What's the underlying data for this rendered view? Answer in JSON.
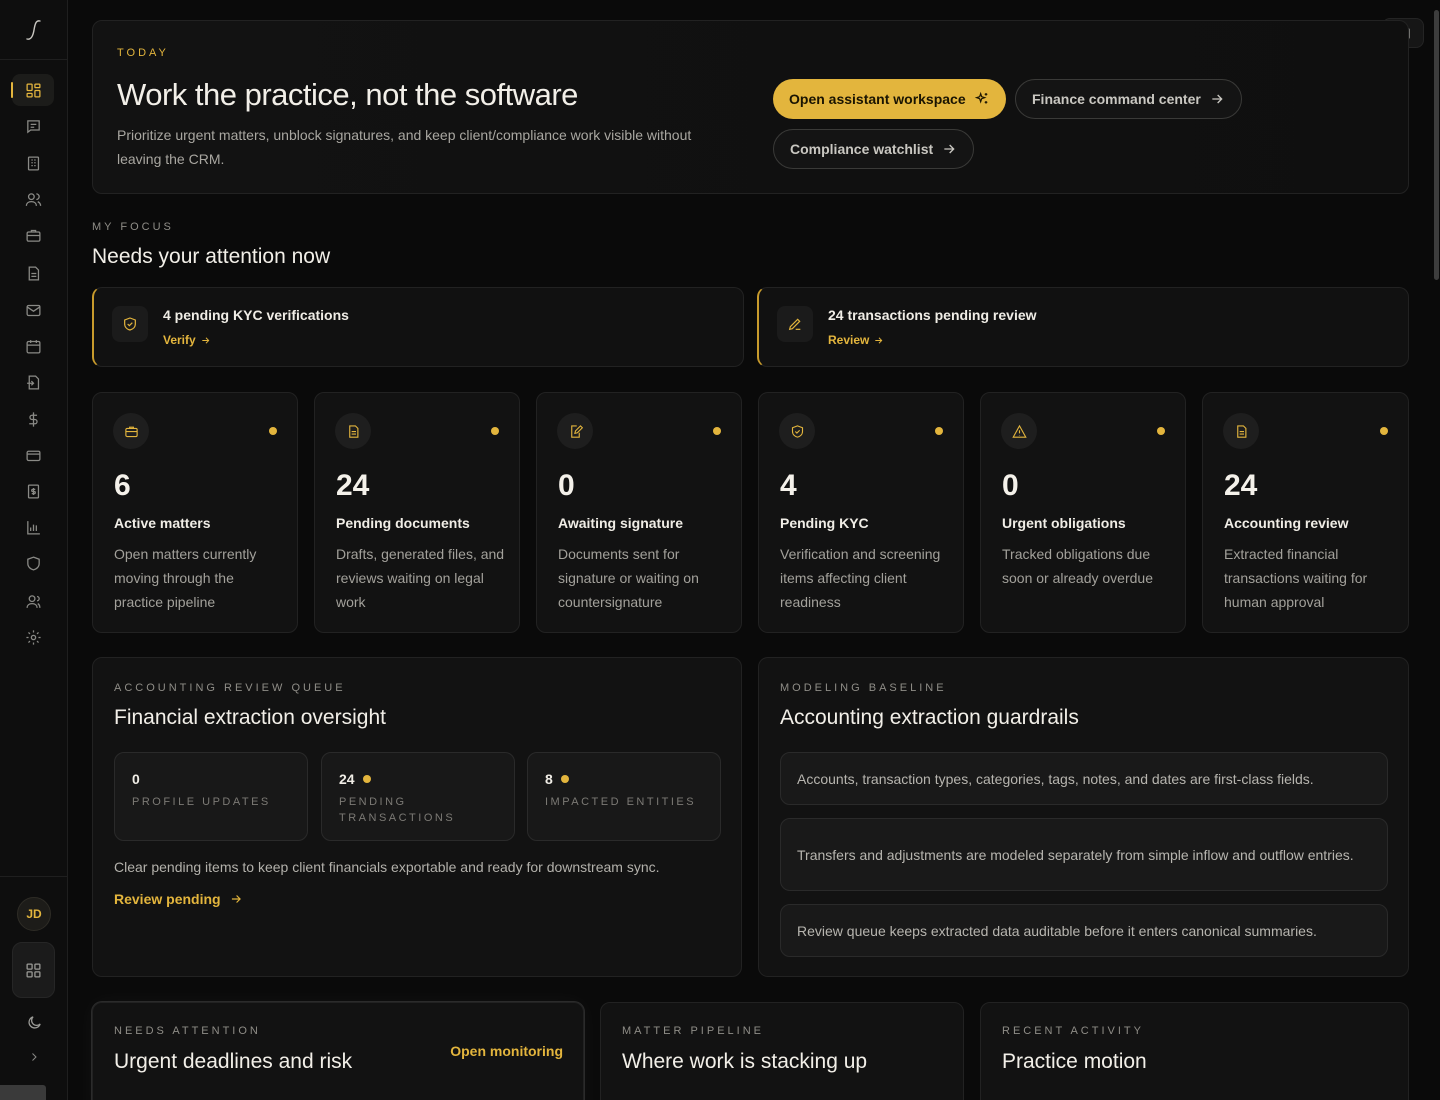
{
  "hero": {
    "eyebrow": "TODAY",
    "title": "Work the practice, not the software",
    "description": "Prioritize urgent matters, unblock signatures, and keep client/compliance work visible without leaving the CRM.",
    "primary_button": "Open assistant workspace",
    "finance_button": "Finance command center",
    "compliance_button": "Compliance watchlist"
  },
  "sidebar": {
    "avatar_initials": "JD",
    "items": [
      "dashboard-icon",
      "messages-icon",
      "building-icon",
      "users-icon",
      "briefcase-icon",
      "document-icon",
      "mail-icon",
      "calendar-icon",
      "file-import-icon",
      "dollar-icon",
      "card-icon",
      "invoice-icon",
      "chart-icon",
      "shield-icon",
      "team-icon",
      "settings-icon"
    ]
  },
  "focus": {
    "eyebrow": "MY FOCUS",
    "title": "Needs your attention now",
    "items": [
      {
        "title": "4 pending KYC verifications",
        "link": "Verify",
        "icon": "shield-check-icon"
      },
      {
        "title": "24 transactions pending review",
        "link": "Review",
        "icon": "pencil-icon"
      }
    ]
  },
  "stats": [
    {
      "value": "6",
      "label": "Active matters",
      "desc": "Open matters currently moving through the practice pipeline",
      "icon": "briefcase-icon"
    },
    {
      "value": "24",
      "label": "Pending documents",
      "desc": "Drafts, generated files, and reviews waiting on legal work",
      "icon": "document-icon"
    },
    {
      "value": "0",
      "label": "Awaiting signature",
      "desc": "Documents sent for signature or waiting on countersignature",
      "icon": "signature-icon"
    },
    {
      "value": "4",
      "label": "Pending KYC",
      "desc": "Verification and screening items affecting client readiness",
      "icon": "shield-check-icon"
    },
    {
      "value": "0",
      "label": "Urgent obligations",
      "desc": "Tracked obligations due soon or already overdue",
      "icon": "warning-icon"
    },
    {
      "value": "24",
      "label": "Accounting review",
      "desc": "Extracted financial transactions waiting for human approval",
      "icon": "document-icon"
    }
  ],
  "queue": {
    "eyebrow": "ACCOUNTING REVIEW QUEUE",
    "title": "Financial extraction oversight",
    "metrics": [
      {
        "value": "0",
        "label": "PROFILE UPDATES"
      },
      {
        "value": "24",
        "label": "PENDING TRANSACTIONS"
      },
      {
        "value": "8",
        "label": "IMPACTED ENTITIES"
      }
    ],
    "note": "Clear pending items to keep client financials exportable and ready for downstream sync.",
    "action": "Review pending"
  },
  "guardrails": {
    "eyebrow": "MODELING BASELINE",
    "title": "Accounting extraction guardrails",
    "rules": [
      "Accounts, transaction types, categories, tags, notes, and dates are first-class fields.",
      "Transfers and adjustments are modeled separately from simple inflow and outflow entries.",
      "Review queue keeps extracted data auditable before it enters canonical summaries."
    ]
  },
  "bottom": [
    {
      "eyebrow": "NEEDS ATTENTION",
      "title": "Urgent deadlines and risk",
      "action": "Open monitoring"
    },
    {
      "eyebrow": "MATTER PIPELINE",
      "title": "Where work is stacking up"
    },
    {
      "eyebrow": "RECENT ACTIVITY",
      "title": "Practice motion"
    }
  ],
  "colors": {
    "accent": "#e3b53d",
    "background": "#0a0a0a",
    "card": "#121212"
  }
}
